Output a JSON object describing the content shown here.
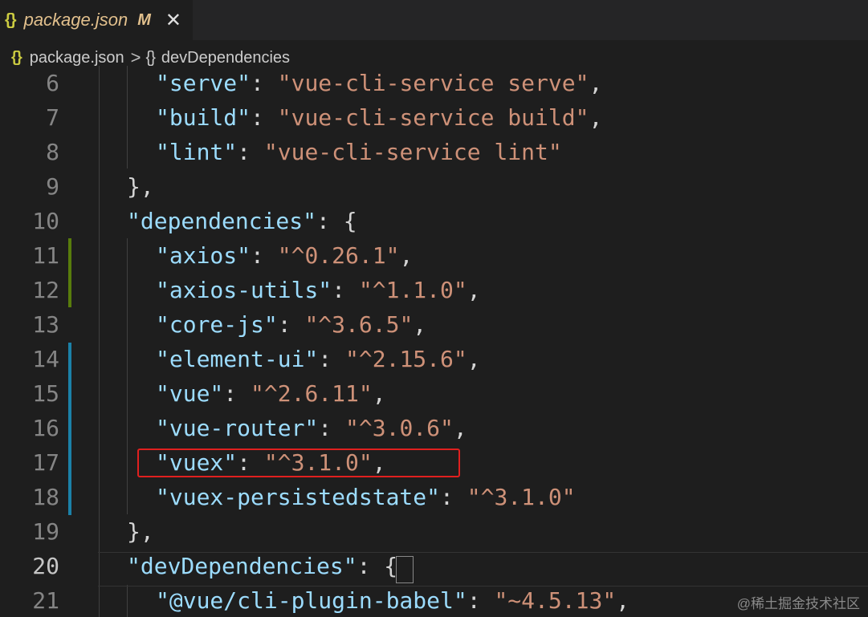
{
  "tab": {
    "icon": "{}",
    "filename": "package.json",
    "modified_flag": "M",
    "close_icon": "✕"
  },
  "breadcrumb": {
    "file_icon": "{}",
    "file": "package.json",
    "separator": ">",
    "object_icon": "{}",
    "symbol": "devDependencies"
  },
  "lines": [
    {
      "n": "6",
      "key": "\"serve\"",
      "sep": ": ",
      "val": "\"vue-cli-service serve\"",
      "tail": ","
    },
    {
      "n": "7",
      "key": "\"build\"",
      "sep": ": ",
      "val": "\"vue-cli-service build\"",
      "tail": ","
    },
    {
      "n": "8",
      "key": "\"lint\"",
      "sep": ": ",
      "val": "\"vue-cli-service lint\"",
      "tail": ""
    },
    {
      "n": "9",
      "text": "},"
    },
    {
      "n": "10",
      "key": "\"dependencies\"",
      "sep": ": ",
      "val": "",
      "tail": "{"
    },
    {
      "n": "11",
      "key": "\"axios\"",
      "sep": ": ",
      "val": "\"^0.26.1\"",
      "tail": ","
    },
    {
      "n": "12",
      "key": "\"axios-utils\"",
      "sep": ": ",
      "val": "\"^1.1.0\"",
      "tail": ","
    },
    {
      "n": "13",
      "key": "\"core-js\"",
      "sep": ": ",
      "val": "\"^3.6.5\"",
      "tail": ","
    },
    {
      "n": "14",
      "key": "\"element-ui\"",
      "sep": ": ",
      "val": "\"^2.15.6\"",
      "tail": ","
    },
    {
      "n": "15",
      "key": "\"vue\"",
      "sep": ": ",
      "val": "\"^2.6.11\"",
      "tail": ","
    },
    {
      "n": "16",
      "key": "\"vue-router\"",
      "sep": ": ",
      "val": "\"^3.0.6\"",
      "tail": ","
    },
    {
      "n": "17",
      "key": "\"vuex\"",
      "sep": ": ",
      "val": "\"^3.1.0\"",
      "tail": ","
    },
    {
      "n": "18",
      "key": "\"vuex-persistedstate\"",
      "sep": ": ",
      "val": "\"^3.1.0\"",
      "tail": ""
    },
    {
      "n": "19",
      "text": "},"
    },
    {
      "n": "20",
      "key": "\"devDependencies\"",
      "sep": ": ",
      "val": "",
      "tail": "{"
    },
    {
      "n": "21",
      "key": "\"@vue/cli-plugin-babel\"",
      "sep": ": ",
      "val": "\"~4.5.13\"",
      "tail": ","
    }
  ],
  "active_line": "20",
  "watermark": "@稀土掘金技术社区",
  "colors": {
    "background": "#1e1e1e",
    "key": "#9cdcfe",
    "string": "#ce9178",
    "added_gutter": "#587c0c",
    "modified_gutter": "#1b81a8",
    "annotation_box": "#e0201f"
  }
}
